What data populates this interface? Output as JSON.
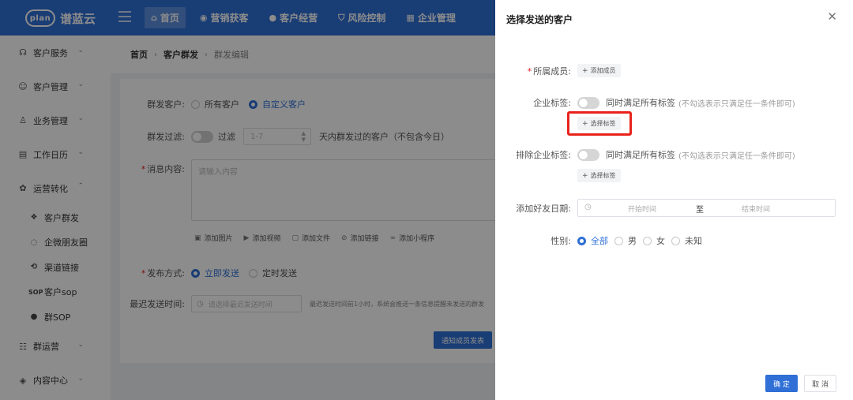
{
  "app": {
    "logo_mark": "plan",
    "logo_text": "谱蓝云"
  },
  "topnav": [
    {
      "label": "首页",
      "icon": "home-icon",
      "active": true
    },
    {
      "label": "营销获客",
      "icon": "marketing-icon"
    },
    {
      "label": "客户经营",
      "icon": "user-icon"
    },
    {
      "label": "风险控制",
      "icon": "shield-icon"
    },
    {
      "label": "企业管理",
      "icon": "building-icon"
    }
  ],
  "sidebar": {
    "items": [
      {
        "label": "客户服务",
        "icon": "service-icon"
      },
      {
        "label": "客户管理",
        "icon": "customer-icon"
      },
      {
        "label": "业务管理",
        "icon": "business-icon"
      },
      {
        "label": "工作日历",
        "icon": "calendar-icon"
      },
      {
        "label": "运营转化",
        "icon": "operation-icon",
        "expanded": true
      }
    ],
    "sub_items": [
      {
        "label": "客户群发",
        "icon": "group-send-icon"
      },
      {
        "label": "企微朋友圈",
        "icon": "moments-icon"
      },
      {
        "label": "渠道链接",
        "icon": "link-icon"
      },
      {
        "label": "客户sop",
        "icon": "sop-icon",
        "icon_text": "SOP"
      },
      {
        "label": "群SOP",
        "icon": "chat-icon"
      }
    ],
    "bottom_items": [
      {
        "label": "群运营",
        "icon": "group-icon"
      },
      {
        "label": "内容中心",
        "icon": "content-icon"
      }
    ]
  },
  "breadcrumb": [
    "首页",
    "客户群发",
    "群发编辑"
  ],
  "form": {
    "recipients_label": "群发客户:",
    "recipients_options": [
      "所有客户",
      "自定义客户"
    ],
    "recipients_selected": "自定义客户",
    "filter_label": "群发过滤:",
    "filter_switch_text": "过滤",
    "filter_days_placeholder": "1-7",
    "filter_suffix": "天内群发过的客户（不包含今日）",
    "content_label": "消息内容:",
    "content_placeholder": "请输入内容",
    "tools": [
      {
        "label": "添加图片",
        "icon": "image-icon"
      },
      {
        "label": "添加视频",
        "icon": "video-icon"
      },
      {
        "label": "添加文件",
        "icon": "file-icon"
      },
      {
        "label": "添加链接",
        "icon": "link-icon"
      },
      {
        "label": "添加小程序",
        "icon": "miniprogram-icon"
      }
    ],
    "publish_label": "发布方式:",
    "publish_options": [
      "立即发送",
      "定时发送"
    ],
    "publish_selected": "立即发送",
    "latest_label": "最迟发送时间:",
    "latest_placeholder": "请选择最迟发送时间",
    "latest_hint": "最迟发送时间前1小时，系统会推送一条信息提醒未发送的群发",
    "notify_button": "通知成员发表"
  },
  "drawer": {
    "title": "选择发送的客户",
    "members_label": "所属成员:",
    "add_member": "添加成员",
    "tags_label": "企业标签:",
    "tags_switch_text": "同时满足所有标签",
    "tags_note": "(不勾选表示只满足任一条件即可)",
    "select_tag": "选择标签",
    "exclude_label": "排除企业标签:",
    "exclude_switch_text": "同时满足所有标签",
    "exclude_note": "(不勾选表示只满足任一条件即可)",
    "exclude_select_tag": "选择标签",
    "date_label": "添加好友日期:",
    "date_start": "开始时间",
    "date_sep": "至",
    "date_end": "结束时间",
    "gender_label": "性别:",
    "gender_options": [
      "全部",
      "男",
      "女",
      "未知"
    ],
    "gender_selected": "全部",
    "confirm": "确 定",
    "cancel": "取 消"
  },
  "colors": {
    "primary": "#2f6fd6",
    "highlight": "#e8231c"
  }
}
